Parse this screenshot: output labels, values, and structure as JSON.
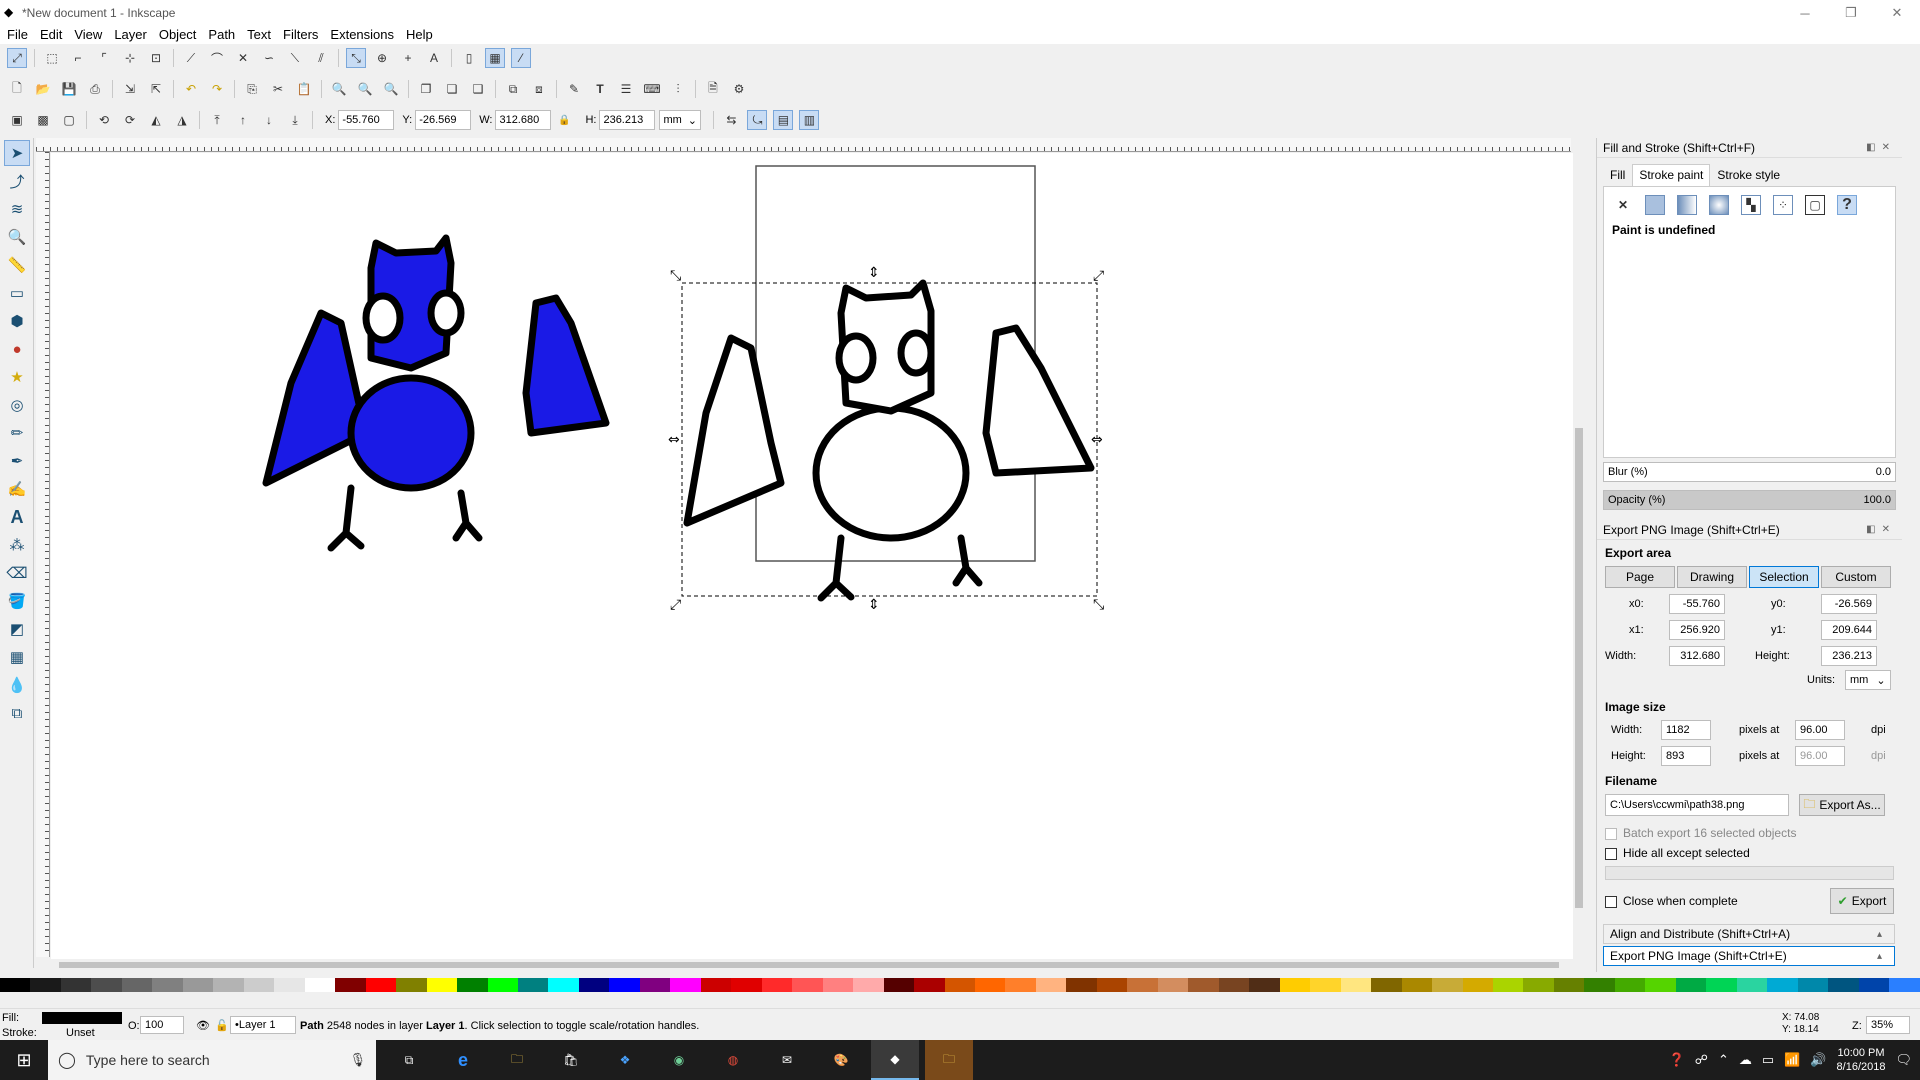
{
  "window": {
    "title": "*New document 1 - Inkscape",
    "minimize": "─",
    "maximize": "❐",
    "close": "✕"
  },
  "menu": [
    "File",
    "Edit",
    "View",
    "Layer",
    "Object",
    "Path",
    "Text",
    "Filters",
    "Extensions",
    "Help"
  ],
  "toolcontrols": {
    "x_label": "X:",
    "x": "-55.760",
    "y_label": "Y:",
    "y": "-26.569",
    "w_label": "W:",
    "w": "312.680",
    "h_label": "H:",
    "h": "236.213",
    "units": "mm"
  },
  "fill_stroke": {
    "title": "Fill and Stroke (Shift+Ctrl+F)",
    "tabs": [
      "Fill",
      "Stroke paint",
      "Stroke style"
    ],
    "paint_status": "Paint is undefined",
    "blur_label": "Blur (%)",
    "blur": "0.0",
    "opacity_label": "Opacity (%)",
    "opacity": "100.0",
    "unset_glyph": "✕",
    "undefined_glyph": "?"
  },
  "export": {
    "title": "Export PNG Image (Shift+Ctrl+E)",
    "area_label": "Export area",
    "area_buttons": [
      "Page",
      "Drawing",
      "Selection",
      "Custom"
    ],
    "selected_area": "Selection",
    "x0_label": "x0:",
    "x0": "-55.760",
    "y0_label": "y0:",
    "y0": "-26.569",
    "x1_label": "x1:",
    "x1": "256.920",
    "y1_label": "y1:",
    "y1": "209.644",
    "width_label": "Width:",
    "width": "312.680",
    "height_label": "Height:",
    "height": "236.213",
    "units_label": "Units:",
    "units": "mm",
    "image_size_label": "Image size",
    "img_width": "1182",
    "img_height": "893",
    "pixels_at": "pixels at",
    "dpi_w": "96.00",
    "dpi_h": "96.00",
    "dpi": "dpi",
    "filename_label": "Filename",
    "filename": "C:\\Users\\ccwmi\\path38.png",
    "export_as": "Export As...",
    "batch_label": "Batch export 16 selected objects",
    "hide_label": "Hide all except selected",
    "close_label": "Close when complete",
    "export_btn": "Export"
  },
  "collapsed_panels": [
    "Align and Distribute (Shift+Ctrl+A)",
    "Export PNG Image (Shift+Ctrl+E)"
  ],
  "status": {
    "fill_label": "Fill:",
    "stroke_label": "Stroke:",
    "stroke_value": "Unset",
    "opacity_label": "O:",
    "opacity": "100",
    "layer": "•Layer 1",
    "message_bold": "Path",
    "message": " 2548 nodes in layer ",
    "message_layer": "Layer 1",
    "message_tail": ". Click selection to toggle scale/rotation handles.",
    "coord_x_label": "X:",
    "coord_x": "74.08",
    "coord_y_label": "Y:",
    "coord_y": "18.14",
    "zoom_label": "Z:",
    "zoom": "35%"
  },
  "taskbar": {
    "search_placeholder": "Type here to search",
    "time": "10:00 PM",
    "date": "8/16/2018"
  },
  "palette": [
    "#000000",
    "#1a1a1a",
    "#333333",
    "#4d4d4d",
    "#666666",
    "#808080",
    "#999999",
    "#b3b3b3",
    "#cccccc",
    "#e6e6e6",
    "#ffffff",
    "#800000",
    "#ff0000",
    "#808000",
    "#ffff00",
    "#008000",
    "#00ff00",
    "#008080",
    "#00ffff",
    "#000080",
    "#0000ff",
    "#800080",
    "#ff00ff",
    "#cc0000",
    "#e00000",
    "#ff2a2a",
    "#ff5555",
    "#ff8080",
    "#ffaaaa",
    "#550000",
    "#aa0000",
    "#d45500",
    "#ff6600",
    "#ff7f2a",
    "#ffb380",
    "#803300",
    "#aa4400",
    "#c87137",
    "#d38d5f",
    "#a05a2c",
    "#784421",
    "#502d16",
    "#ffcc00",
    "#ffd42a",
    "#ffe680",
    "#806600",
    "#aa8800",
    "#c8ab37",
    "#d4aa00",
    "#aad400",
    "#88aa00",
    "#668000",
    "#338000",
    "#44aa00",
    "#55d400",
    "#00aa44",
    "#00d455",
    "#2ad4a0",
    "#00aad4",
    "#0088aa",
    "#005580",
    "#0044aa",
    "#2a7fff"
  ]
}
